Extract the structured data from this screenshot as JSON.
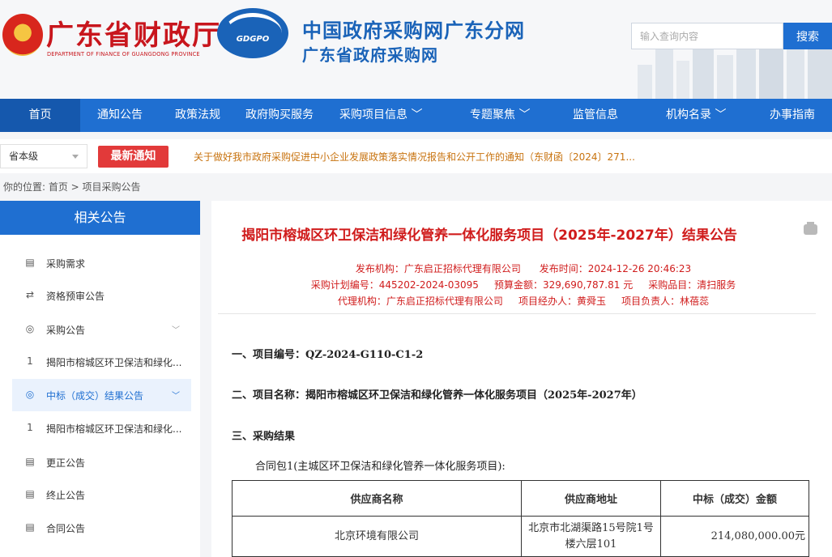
{
  "header": {
    "brand_cn": "广东省财政厅",
    "brand_en": "DEPARTMENT OF FINANCE OF GUANGDONG PROVINCE",
    "logo_text": "GDGPO",
    "site_title": "中国政府采购网广东分网",
    "site_subtitle": "广东省政府采购网",
    "search_placeholder": "输入查询内容",
    "search_button": "搜索"
  },
  "nav": {
    "items": [
      "首页",
      "通知公告",
      "政策法规",
      "政府购买服务",
      "采购项目信息",
      "专题聚焦",
      "监管信息",
      "机构名录",
      "办事指南"
    ]
  },
  "notice": {
    "level": "省本级",
    "tag": "最新通知",
    "text": "关于做好我市政府采购促进中小企业发展政策落实情况报告和公开工作的通知（东财函〔2024〕271..."
  },
  "breadcrumb": "你的位置:  首页 > 项目采购公告",
  "sidebar": {
    "title": "相关公告",
    "items": [
      {
        "label": "采购需求",
        "icon": "document-icon"
      },
      {
        "label": "资格预审公告",
        "icon": "swap-icon"
      },
      {
        "label": "采购公告",
        "icon": "target-icon"
      },
      {
        "label": "揭阳市榕城区环卫保洁和绿化...",
        "icon": "index-1"
      },
      {
        "label": "中标（成交）结果公告",
        "icon": "target-icon"
      },
      {
        "label": "揭阳市榕城区环卫保洁和绿化...",
        "icon": "index-1"
      },
      {
        "label": "更正公告",
        "icon": "document-icon"
      },
      {
        "label": "终止公告",
        "icon": "document-icon"
      },
      {
        "label": "合同公告",
        "icon": "document-icon"
      }
    ],
    "index_label": "1"
  },
  "article": {
    "title": "揭阳市榕城区环卫保洁和绿化管养一体化服务项目（2025年-2027年）结果公告",
    "meta": {
      "publisher": "发布机构：广东启正招标代理有限公司",
      "publish_time": "发布时间：2024-12-26 20:46:23",
      "plan_no": "采购计划编号：445202-2024-03095",
      "budget": "预算金额：329,690,787.81 元",
      "category": "采购品目：清扫服务",
      "agent": "代理机构：广东启正招标代理有限公司",
      "handler": "项目经办人：黄舜玉",
      "manager": "项目负责人：林蓓蕊"
    },
    "section1": "一、项目编号：QZ-2024-G110-C1-2",
    "section2": "二、项目名称：揭阳市榕城区环卫保洁和绿化管养一体化服务项目（2025年-2027年）",
    "section3": "三、采购结果",
    "package": "合同包1(主城区环卫保洁和绿化管养一体化服务项目):",
    "table": {
      "headers": [
        "供应商名称",
        "供应商地址",
        "中标（成交）金额"
      ],
      "rows": [
        {
          "name": "北京环境有限公司",
          "addr1": "北京市北湖渠路15号院1号",
          "addr2": "楼六层101",
          "amount": "214,080,000.00元"
        }
      ]
    }
  },
  "colors": {
    "primary": "#1f6fd1",
    "accent_red": "#d01c1c",
    "notice_orange": "#c8730f"
  }
}
